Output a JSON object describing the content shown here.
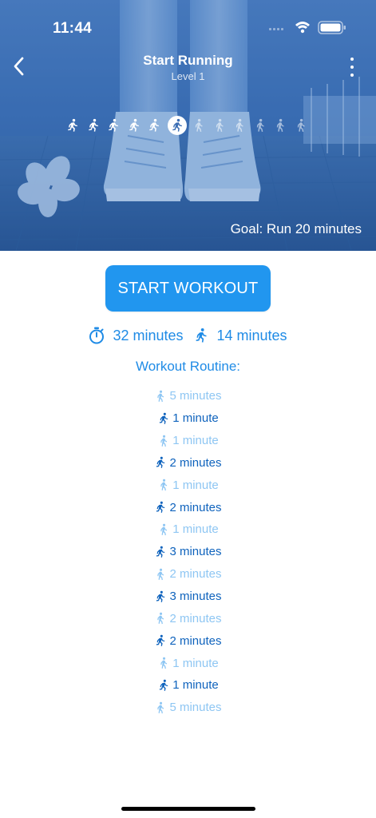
{
  "status_bar": {
    "time": "11:44"
  },
  "header": {
    "title": "Start Running",
    "subtitle": "Level 1"
  },
  "levels": {
    "current_index": 5,
    "items": [
      "run",
      "run",
      "run",
      "run",
      "run",
      "current",
      "walk",
      "walk",
      "walk",
      "walk",
      "walk",
      "walk"
    ]
  },
  "goal": "Goal: Run 20 minutes",
  "start_button": "START WORKOUT",
  "stats": {
    "total": "32 minutes",
    "running": "14 minutes"
  },
  "routine_title": "Workout Routine:",
  "routine": [
    {
      "type": "walk",
      "label": "5 minutes"
    },
    {
      "type": "run",
      "label": "1 minute"
    },
    {
      "type": "walk",
      "label": "1 minute"
    },
    {
      "type": "run",
      "label": "2 minutes"
    },
    {
      "type": "walk",
      "label": "1 minute"
    },
    {
      "type": "run",
      "label": "2 minutes"
    },
    {
      "type": "walk",
      "label": "1 minute"
    },
    {
      "type": "run",
      "label": "3 minutes"
    },
    {
      "type": "walk",
      "label": "2 minutes"
    },
    {
      "type": "run",
      "label": "3 minutes"
    },
    {
      "type": "walk",
      "label": "2 minutes"
    },
    {
      "type": "run",
      "label": "2 minutes"
    },
    {
      "type": "walk",
      "label": "1 minute"
    },
    {
      "type": "run",
      "label": "1 minute"
    },
    {
      "type": "walk",
      "label": "5 minutes"
    }
  ],
  "colors": {
    "accent": "#2196ef",
    "text_blue": "#1f8be6",
    "run_item": "#0f63bd",
    "walk_item": "#8ec6f3",
    "hero_tint": "#3d6fb4"
  },
  "icons": {
    "back": "chevron-left-icon",
    "more": "more-vertical-icon",
    "timer": "stopwatch-icon",
    "run": "runner-icon",
    "walk": "walker-icon"
  }
}
